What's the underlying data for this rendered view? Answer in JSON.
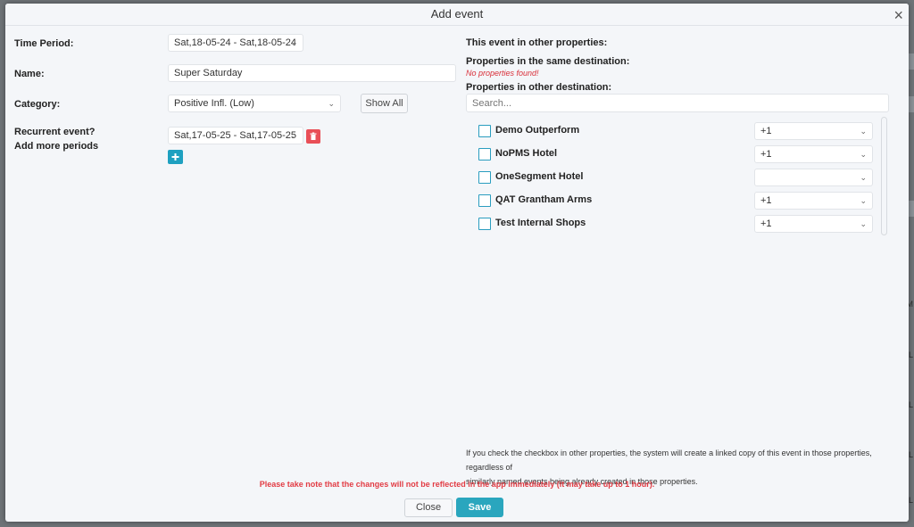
{
  "background": {
    "side_letters": [
      "M",
      "L",
      "L",
      "L",
      "L"
    ]
  },
  "modal": {
    "title": "Add event",
    "close_icon": "×"
  },
  "form": {
    "time_period": {
      "label": "Time Period:",
      "value": "Sat,18-05-24 - Sat,18-05-24"
    },
    "name": {
      "label": "Name:",
      "value": "Super Saturday"
    },
    "category": {
      "label": "Category:",
      "value": "Positive Infl. (Low)",
      "show_all_label": "Show All"
    },
    "recurrent": {
      "label": "Recurrent event?",
      "add_more_label": "Add more periods",
      "period_value": "Sat,17-05-25 - Sat,17-05-25",
      "delete_icon": "trash-icon",
      "add_icon": "plus-icon"
    }
  },
  "properties": {
    "heading": "This event in other properties:",
    "same_destination_label": "Properties in the same destination:",
    "no_properties": "No properties found!",
    "other_destination_label": "Properties in other destination:",
    "search_placeholder": "Search...",
    "items": [
      {
        "name": "Demo Outperform",
        "value": "+1",
        "checked": false
      },
      {
        "name": "NoPMS Hotel",
        "value": "+1",
        "checked": false
      },
      {
        "name": "OneSegment Hotel",
        "value": "",
        "checked": false
      },
      {
        "name": "QAT Grantham Arms",
        "value": "+1",
        "checked": false
      },
      {
        "name": "Test Internal Shops",
        "value": "+1",
        "checked": false
      }
    ],
    "info_line1": "If you check the checkbox in other properties, the system will create a linked copy of this event in those properties, regardless of",
    "info_line2": "similarly named events being already created in those properties."
  },
  "footer": {
    "note": "Please take note that the changes will not be reflected in the app immediately (it may take up to 1 hour).",
    "close_label": "Close",
    "save_label": "Save"
  },
  "colors": {
    "accent": "#2aa6be",
    "danger": "#e94f57",
    "warning_text": "#e23c44"
  }
}
